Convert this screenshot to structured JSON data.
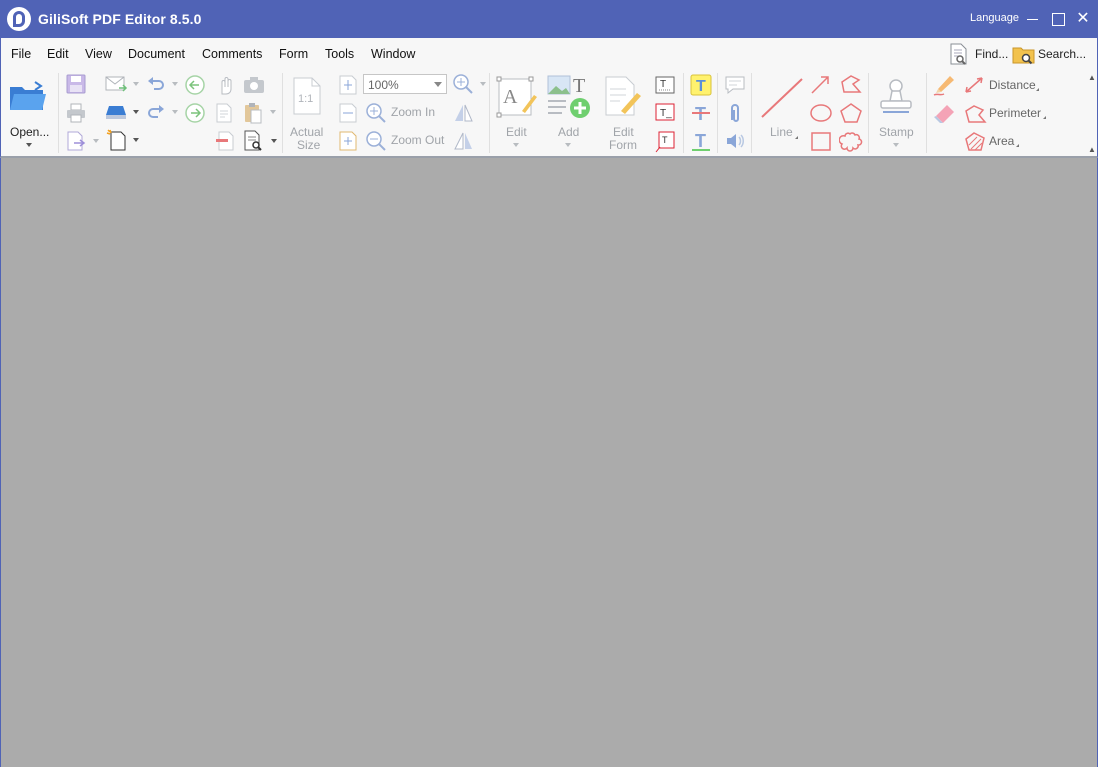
{
  "window": {
    "title": "GiliSoft PDF Editor 8.5.0",
    "language_label": "Language",
    "close_glyph": "✕"
  },
  "menu": {
    "items": [
      "File",
      "Edit",
      "View",
      "Document",
      "Comments",
      "Form",
      "Tools",
      "Window"
    ],
    "find_label": "Find...",
    "search_label": "Search..."
  },
  "ribbon": {
    "open_label": "Open...",
    "zoom_value": "100%",
    "actual_size_label_1": "Actual",
    "actual_size_label_2": "Size",
    "zoom_in_label": "Zoom In",
    "zoom_out_label": "Zoom Out",
    "edit_label": "Edit",
    "add_label": "Add",
    "edit_form_label_1": "Edit",
    "edit_form_label_2": "Form",
    "line_label": "Line",
    "stamp_label": "Stamp",
    "distance_label": "Distance",
    "perimeter_label": "Perimeter",
    "area_label": "Area",
    "collapse_glyph": "▲"
  },
  "colors": {
    "titlebar": "#5063b6",
    "ribbon_bg": "#f7f7f7",
    "workspace": "#ababab",
    "markup_red": "#e8787a",
    "disabled_text": "#a0a4a9"
  },
  "icons": [
    "open-folder-icon",
    "save-icon",
    "print-icon",
    "email-icon",
    "undo-icon",
    "redo-icon",
    "back-icon",
    "forward-icon",
    "hand-icon",
    "snapshot-icon",
    "zoom-in-icon",
    "zoom-out-icon",
    "edit-text-icon",
    "add-object-icon",
    "edit-form-icon",
    "typewriter-icon",
    "note-icon",
    "attach-icon",
    "sound-icon",
    "line-icon",
    "arrow-icon",
    "ellipse-icon",
    "rectangle-icon",
    "polygon-icon",
    "cloud-icon",
    "stamp-icon",
    "pencil-icon",
    "eraser-icon",
    "distance-icon",
    "perimeter-icon",
    "area-icon",
    "find-icon",
    "search-icon"
  ]
}
